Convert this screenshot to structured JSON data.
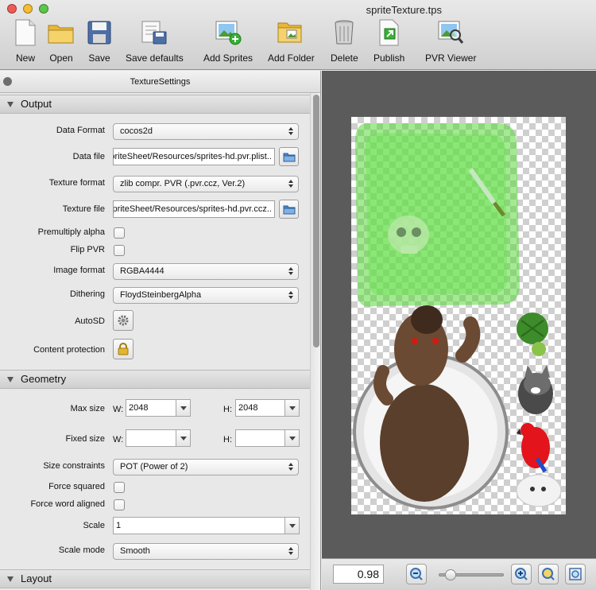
{
  "window": {
    "title": "spriteTexture.tps"
  },
  "toolbar": {
    "new": "New",
    "open": "Open",
    "save": "Save",
    "save_defaults": "Save defaults",
    "add_sprites": "Add Sprites",
    "add_folder": "Add Folder",
    "delete": "Delete",
    "publish": "Publish",
    "pvr_viewer": "PVR Viewer"
  },
  "panel": {
    "title": "TextureSettings"
  },
  "output": {
    "header": "Output",
    "data_format_label": "Data Format",
    "data_format_value": "cocos2d",
    "data_file_label": "Data file",
    "data_file_value": "..SpriteSheet/Resources/sprites-hd.pvr.plist",
    "texture_format_label": "Texture format",
    "texture_format_value": "zlib compr. PVR (.pvr.ccz, Ver.2)",
    "texture_file_label": "Texture file",
    "texture_file_value": "..SpriteSheet/Resources/sprites-hd.pvr.ccz",
    "premultiply_label": "Premultiply alpha",
    "premultiply_checked": false,
    "flip_pvr_label": "Flip PVR",
    "flip_pvr_checked": false,
    "image_format_label": "Image format",
    "image_format_value": "RGBA4444",
    "dithering_label": "Dithering",
    "dithering_value": "FloydSteinbergAlpha",
    "autosd_label": "AutoSD",
    "content_protection_label": "Content protection"
  },
  "geometry": {
    "header": "Geometry",
    "max_size_label": "Max size",
    "w_label": "W:",
    "h_label": "H:",
    "max_w": "2048",
    "max_h": "2048",
    "fixed_size_label": "Fixed size",
    "fixed_w": "",
    "fixed_h": "",
    "size_constraints_label": "Size constraints",
    "size_constraints_value": "POT (Power of 2)",
    "force_squared_label": "Force squared",
    "force_squared_checked": false,
    "force_word_aligned_label": "Force word aligned",
    "force_word_aligned_checked": false,
    "scale_label": "Scale",
    "scale_value": "1",
    "scale_mode_label": "Scale mode",
    "scale_mode_value": "Smooth"
  },
  "layout": {
    "header": "Layout"
  },
  "preview": {
    "zoom": "0.98",
    "zoom_slider_fraction": 0.1
  },
  "colors": {
    "accent_green": "#57d93a",
    "canvas_bg": "#5b5b5b",
    "bear_brown": "#5a3f2c",
    "parrot_red": "#e3141b",
    "turtle_green": "#3d8b2a"
  },
  "icons": [
    "new-doc-icon",
    "open-folder-icon",
    "save-disk-icon",
    "save-defaults-icon",
    "add-sprites-icon",
    "add-folder-icon",
    "trash-icon",
    "publish-icon",
    "pvr-viewer-icon",
    "folder-icon",
    "gear-icon",
    "lock-icon",
    "zoom-out-icon",
    "zoom-in-icon",
    "zoom-fit-icon",
    "zoom-actual-icon"
  ]
}
